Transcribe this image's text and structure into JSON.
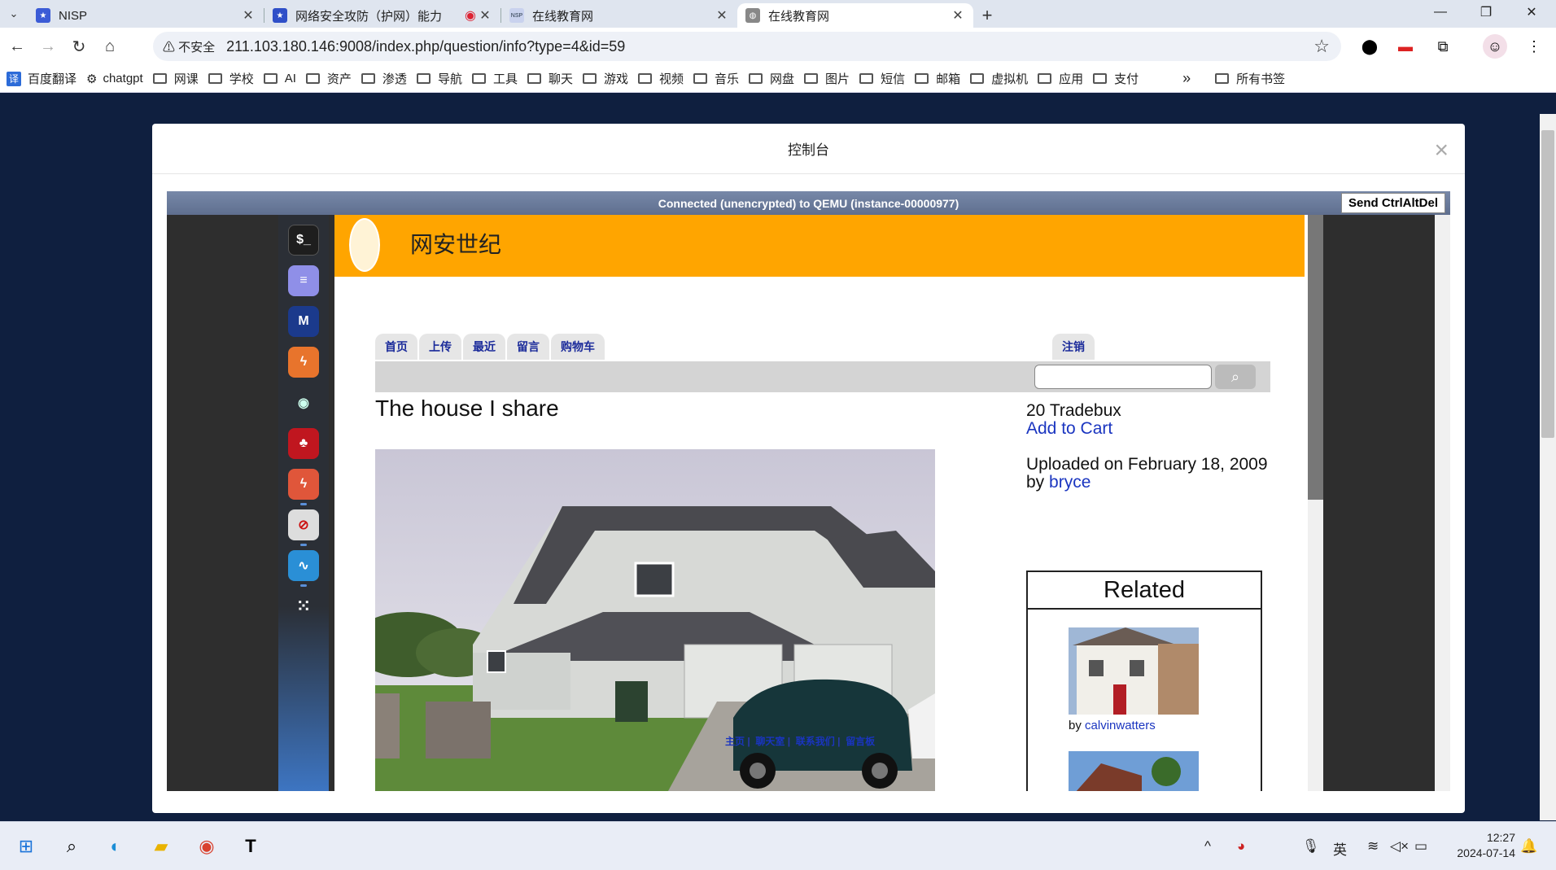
{
  "browser": {
    "tabs": [
      {
        "title": "NISP",
        "fav_color": "#3b5bd6",
        "fav_glyph": "★",
        "active": false
      },
      {
        "title": "网络安全攻防（护网）能力",
        "fav_color": "#2f4fc8",
        "fav_glyph": "★",
        "active": false
      },
      {
        "title": "在线教育网",
        "fav_color": "#c9d2ee",
        "fav_glyph": "NSP",
        "active": false
      },
      {
        "title": "在线教育网",
        "fav_color": "#888888",
        "fav_glyph": "◍",
        "active": true
      }
    ],
    "new_tab": "+",
    "security_label": "⚠ 不安全",
    "url": "211.103.180.146:9008/index.php/question/info?type=4&id=59",
    "bookmarks": [
      "百度翻译",
      "chatgpt",
      "网课",
      "学校",
      "AI",
      "资产",
      "渗透",
      "导航",
      "工具",
      "聊天",
      "游戏",
      "视频",
      "音乐",
      "网盘",
      "图片",
      "短信",
      "邮箱",
      "虚拟机",
      "应用",
      "支付"
    ],
    "bookmarks_overflow": "»",
    "all_bookmarks": "所有书签"
  },
  "modal": {
    "title": "控制台",
    "close": "×",
    "vnc_status": "Connected (unencrypted) to QEMU (instance-00000977)",
    "ctrl_alt_del": "Send CtrlAltDel"
  },
  "site": {
    "name": "网安世纪",
    "nav": [
      "首页",
      "上传",
      "最近",
      "留言",
      "购物车"
    ],
    "logout": "注销",
    "search_placeholder": "",
    "post_title": "The house I share",
    "photo_overlay_links": [
      "主页",
      "聊天室",
      "联系我们",
      "留言板"
    ],
    "price": "20 Tradebux",
    "add_to_cart": "Add to Cart",
    "uploaded": "Uploaded on February 18, 2009",
    "by_prefix": "by",
    "author": "bryce",
    "related_title": "Related",
    "related": [
      {
        "by": "by",
        "author": "calvinwatters"
      }
    ]
  },
  "taskbar": {
    "ime": "英",
    "time": "12:27",
    "date": "2024-07-14"
  }
}
